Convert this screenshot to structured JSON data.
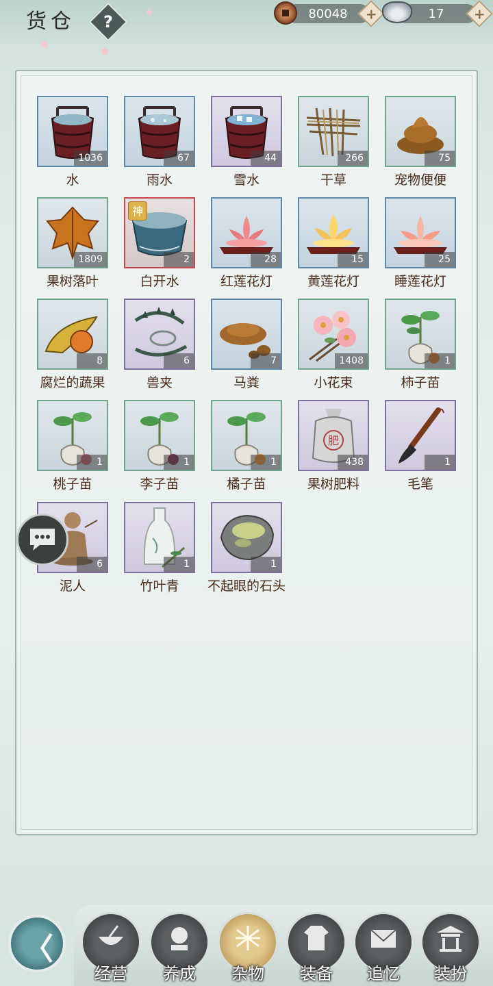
{
  "header": {
    "title": "货仓",
    "help_label": "?",
    "copper": "80048",
    "silver": "17",
    "plus_label": "+"
  },
  "items": [
    {
      "name": "水",
      "count": "1036",
      "icon": "water-bucket-icon"
    },
    {
      "name": "雨水",
      "count": "67",
      "icon": "rainwater-bucket-icon"
    },
    {
      "name": "雪水",
      "count": "44",
      "icon": "snowwater-bucket-icon"
    },
    {
      "name": "干草",
      "count": "266",
      "icon": "hay-icon"
    },
    {
      "name": "宠物便便",
      "count": "75",
      "icon": "pet-poop-icon"
    },
    {
      "name": "果树落叶",
      "count": "1809",
      "icon": "fallen-leaf-icon"
    },
    {
      "name": "白开水",
      "count": "2",
      "icon": "water-bowl-icon",
      "badge": "神"
    },
    {
      "name": "红莲花灯",
      "count": "28",
      "icon": "red-lotus-lamp-icon"
    },
    {
      "name": "黄莲花灯",
      "count": "15",
      "icon": "yellow-lotus-lamp-icon"
    },
    {
      "name": "睡莲花灯",
      "count": "25",
      "icon": "water-lily-lamp-icon"
    },
    {
      "name": "腐烂的蔬果",
      "count": "8",
      "icon": "rotten-fruit-icon"
    },
    {
      "name": "兽夹",
      "count": "6",
      "icon": "bear-trap-icon"
    },
    {
      "name": "马粪",
      "count": "7",
      "icon": "horse-dung-icon"
    },
    {
      "name": "小花束",
      "count": "1408",
      "icon": "flower-bouquet-icon"
    },
    {
      "name": "柿子苗",
      "count": "1",
      "icon": "persimmon-seedling-icon"
    },
    {
      "name": "桃子苗",
      "count": "1",
      "icon": "peach-seedling-icon"
    },
    {
      "name": "李子苗",
      "count": "1",
      "icon": "plum-seedling-icon"
    },
    {
      "name": "橘子苗",
      "count": "1",
      "icon": "orange-seedling-icon"
    },
    {
      "name": "果树肥料",
      "count": "438",
      "icon": "fertilizer-sack-icon"
    },
    {
      "name": "毛笔",
      "count": "1",
      "icon": "brush-icon"
    },
    {
      "name": "泥人",
      "count": "6",
      "icon": "clay-figure-icon"
    },
    {
      "name": "竹叶青",
      "count": "1",
      "icon": "wine-bottle-icon"
    },
    {
      "name": "不起眼的石头",
      "count": "1",
      "icon": "stone-icon"
    }
  ],
  "nav": {
    "tabs": [
      {
        "label": "经营",
        "icon": "bowl-icon"
      },
      {
        "label": "养成",
        "icon": "crystal-ball-icon"
      },
      {
        "label": "杂物",
        "icon": "hay-bundle-icon"
      },
      {
        "label": "装备",
        "icon": "robe-icon"
      },
      {
        "label": "追忆",
        "icon": "letter-icon"
      },
      {
        "label": "装扮",
        "icon": "pavilion-icon"
      }
    ],
    "active_tab": "杂物"
  }
}
